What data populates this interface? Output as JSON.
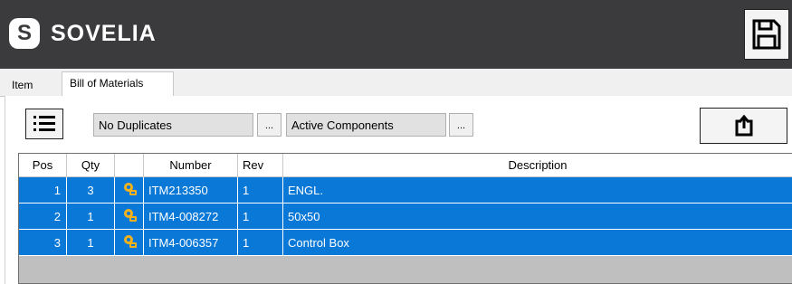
{
  "header": {
    "logo_letter": "S",
    "brand": "SOVELIA",
    "save_icon": "floppy-disk-icon"
  },
  "tabs": [
    {
      "label": "Item"
    },
    {
      "label": "Bill of Materials"
    }
  ],
  "toolbar": {
    "list_icon": "list-icon",
    "duplicates_value": "No Duplicates",
    "components_value": "Active Components",
    "ellipsis": "...",
    "export_icon": "export-upload-icon"
  },
  "grid": {
    "columns": [
      "Pos",
      "Qty",
      "",
      "Number",
      "Rev",
      "Description"
    ],
    "rows": [
      {
        "pos": "1",
        "qty": "3",
        "icon": "item-part-icon",
        "number": "ITM213350",
        "rev": "1",
        "description": "ENGL."
      },
      {
        "pos": "2",
        "qty": "1",
        "icon": "item-part-icon",
        "number": "ITM4-008272",
        "rev": "1",
        "description": "50x50"
      },
      {
        "pos": "3",
        "qty": "1",
        "icon": "item-part-icon",
        "number": "ITM4-006357",
        "rev": "1",
        "description": "Control Box"
      }
    ]
  },
  "colors": {
    "header_bg": "#3b3b3e",
    "selection": "#0a78d7",
    "grid_empty": "#bfbfbf",
    "item_icon": "#f5b21a"
  }
}
